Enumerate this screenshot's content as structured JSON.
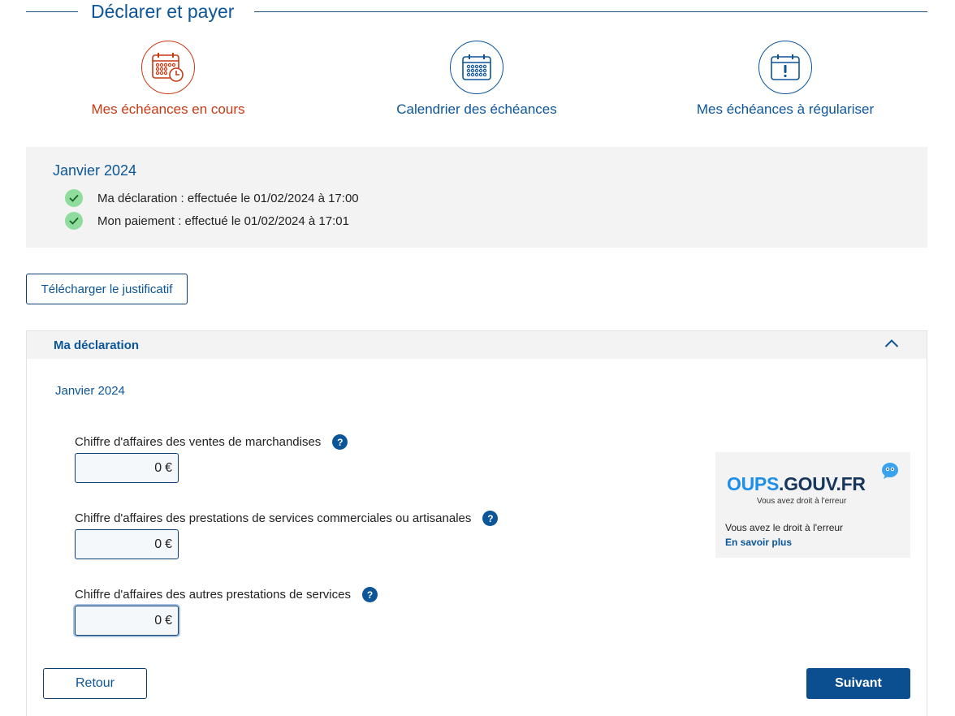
{
  "page": {
    "title": "Déclarer et payer"
  },
  "tiles": [
    {
      "label": "Mes échéances en cours",
      "icon": "calendar-clock-icon",
      "active": true
    },
    {
      "label": "Calendrier des échéances",
      "icon": "calendar-icon",
      "active": false
    },
    {
      "label": "Mes échéances à régulariser",
      "icon": "calendar-alert-icon",
      "active": false
    }
  ],
  "summary": {
    "period": "Janvier 2024",
    "declaration_status": "Ma déclaration : effectuée le 01/02/2024 à 17:00",
    "payment_status": "Mon paiement : effectué le 01/02/2024 à 17:01"
  },
  "actions": {
    "download_label": "Télécharger le justificatif",
    "back_label": "Retour",
    "next_label": "Suivant"
  },
  "panel": {
    "title": "Ma déclaration",
    "period": "Janvier 2024",
    "fields": [
      {
        "label": "Chiffre d'affaires des ventes de marchandises",
        "value": "0",
        "currency": "€"
      },
      {
        "label": "Chiffre d'affaires des prestations de services commerciales ou artisanales",
        "value": "0",
        "currency": "€"
      },
      {
        "label": "Chiffre d'affaires des autres prestations de services",
        "value": "0",
        "currency": "€"
      }
    ],
    "help_glyph": "?"
  },
  "oups": {
    "logo_oups": "OUPS",
    "logo_gouv": ".GOUV.FR",
    "tagline": "Vous avez droit à l'erreur",
    "text": "Vous avez le droit à l'erreur",
    "link": "En savoir plus"
  },
  "colors": {
    "primary": "#0b5598",
    "active": "#c63a14",
    "success": "#8fdc9c",
    "panel_bg": "#f3f3f3"
  }
}
